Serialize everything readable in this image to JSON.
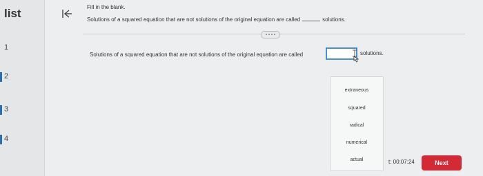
{
  "sidebar": {
    "title": "list",
    "items": [
      {
        "label": "1",
        "active": true
      },
      {
        "label": "2"
      },
      {
        "label": "3"
      },
      {
        "label": "4"
      }
    ]
  },
  "icons": {
    "collapse": "collapse-left-icon",
    "cursor": "text-cursor-icon"
  },
  "instruction": "Fill in the blank.",
  "question_top": {
    "before": "Solutions of a squared equation that are not solutions of the original equation are called",
    "after": "solutions."
  },
  "question_main": {
    "before": "Solutions of a squared equation that are not solutions of the original equation are called",
    "answer_value": "",
    "after": "solutions."
  },
  "dropdown": {
    "options": [
      "extraneous",
      "squared",
      "radical",
      "numerical",
      "actual"
    ]
  },
  "timer": "t: 00:07:24",
  "next_label": "Next",
  "colors": {
    "accent": "#4a8fd6",
    "next_button": "#d42a35",
    "active_item_bar": "#2a6db0"
  }
}
